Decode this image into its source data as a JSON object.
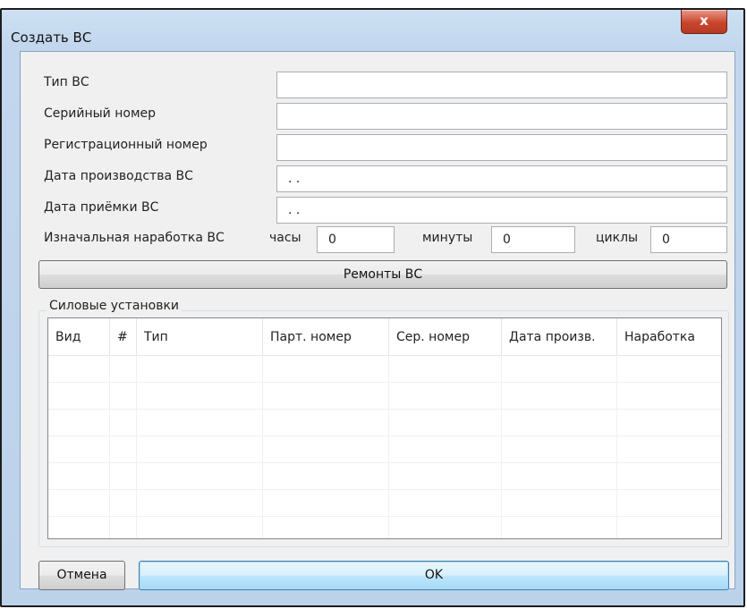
{
  "window": {
    "title": "Создать ВС",
    "close_label": "x"
  },
  "form": {
    "aircraft_type": {
      "label": "Тип ВС",
      "value": ""
    },
    "serial_number": {
      "label": "Серийный номер",
      "value": ""
    },
    "registration_number": {
      "label": "Регистрационный номер",
      "value": ""
    },
    "production_date": {
      "label": "Дата производства ВС",
      "value": ". ."
    },
    "acceptance_date": {
      "label": "Дата приёмки ВС",
      "value": ". ."
    },
    "initial_operating_time": {
      "label": "Изначальная наработка ВС",
      "hours_label": "часы",
      "hours_value": "0",
      "minutes_label": "минуты",
      "minutes_value": "0",
      "cycles_label": "циклы",
      "cycles_value": "0"
    }
  },
  "repairs_button": "Ремонты ВС",
  "power_units": {
    "group_title": "Силовые установки",
    "columns": [
      "Вид",
      "#",
      "Тип",
      "Парт. номер",
      "Сер. номер",
      "Дата произв.",
      "Наработка"
    ],
    "rows": []
  },
  "footer": {
    "cancel_label": "Отмена",
    "ok_label": "OK"
  },
  "colors": {
    "ok_accent": "#3c7fb1",
    "close_red": "#c9452c"
  }
}
